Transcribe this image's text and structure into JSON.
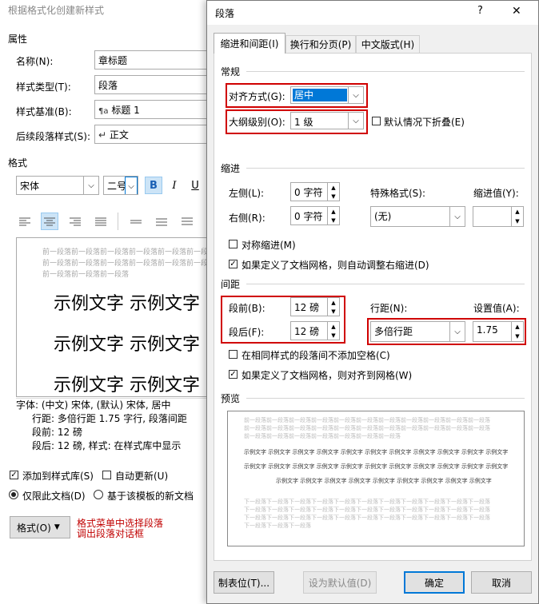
{
  "back_dialog": {
    "title": "根据格式化创建新样式",
    "properties_header": "属性",
    "name_label": "名称(N):",
    "name_value": "章标题",
    "style_type_label": "样式类型(T):",
    "style_type_value": "段落",
    "style_base_label": "样式基准(B):",
    "style_base_value": "标题 1",
    "style_base_icon": "¶a",
    "next_style_label": "后续段落样式(S):",
    "next_style_value": "正文",
    "next_style_icon": "↵",
    "format_header": "格式",
    "font_value": "宋体",
    "size_value": "二号",
    "bold": "B",
    "italic": "I",
    "underline": "U",
    "preview_prev_line1": "前一段落前一段落前一段落前一段落前一段落前一段落",
    "preview_prev_line2": "前一段落前一段落前一段落前一段落前一段落前一段落",
    "preview_prev_line3": "前一段落前一段落前一段落",
    "sample_text": "示例文字  示例文字",
    "desc_line1": "字体: (中文) 宋体, (默认) 宋体, 居中",
    "desc_line2": "行距: 多倍行距 1.75 字行, 段落间距",
    "desc_line3": "段前: 12 磅",
    "desc_line4": "段后: 12 磅, 样式: 在样式库中显示",
    "add_to_gallery": "添加到样式库(S)",
    "auto_update": "自动更新(U)",
    "only_this_doc": "仅限此文档(D)",
    "new_docs_template": "基于该模板的新文档",
    "format_button": "格式(O)",
    "annotation_line1": "格式菜单中选择段落",
    "annotation_line2": "调出段落对话框"
  },
  "dialog": {
    "title": "段落",
    "help": "?",
    "close": "✕",
    "tabs": [
      "缩进和间距(I)",
      "换行和分页(P)",
      "中文版式(H)"
    ],
    "general_header": "常规",
    "alignment_label": "对齐方式(G):",
    "alignment_value": "居中",
    "outline_label": "大纲级别(O):",
    "outline_value": "1 级",
    "collapse_default": "默认情况下折叠(E)",
    "indent_header": "缩进",
    "left_label": "左侧(L):",
    "left_value": "0 字符",
    "right_label": "右侧(R):",
    "right_value": "0 字符",
    "special_label": "特殊格式(S):",
    "special_value": "(无)",
    "indent_by_label": "缩进值(Y):",
    "indent_by_value": "",
    "mirror_indent": "对称缩进(M)",
    "auto_adjust_right": "如果定义了文档网格，则自动调整右缩进(D)",
    "spacing_header": "间距",
    "before_label": "段前(B):",
    "before_value": "12 磅",
    "after_label": "段后(F):",
    "after_value": "12 磅",
    "line_spacing_label": "行距(N):",
    "line_spacing_value": "多倍行距",
    "at_label": "设置值(A):",
    "at_value": "1.75",
    "no_space_same_style": "在相同样式的段落间不添加空格(C)",
    "snap_to_grid": "如果定义了文档网格，则对齐到网格(W)",
    "preview_header": "预览",
    "preview_prev": [
      "前一段落前一段落前一段落前一段落前一段落前一段落前一段落前一段落前一段落前一段落前一段落",
      "前一段落前一段落前一段落前一段落前一段落前一段落前一段落前一段落前一段落前一段落前一段落",
      "前一段落前一段落前一段落前一段落前一段落前一段落前一段落"
    ],
    "preview_sample": [
      "示例文字 示例文字 示例文字 示例文字 示例文字 示例文字 示例文字 示例文字 示例文字 示例文字 示例文字",
      "示例文字 示例文字 示例文字 示例文字 示例文字 示例文字 示例文字 示例文字 示例文字 示例文字 示例文字",
      "示例文字 示例文字 示例文字 示例文字 示例文字 示例文字 示例文字 示例文字 示例文字"
    ],
    "preview_next": [
      "下一段落下一段落下一段落下一段落下一段落下一段落下一段落下一段落下一段落下一段落下一段落",
      "下一段落下一段落下一段落下一段落下一段落下一段落下一段落下一段落下一段落下一段落下一段落",
      "下一段落下一段落下一段落下一段落下一段落下一段落下一段落下一段落下一段落下一段落下一段落",
      "下一段落下一段落下一段落"
    ],
    "tabs_button": "制表位(T)...",
    "set_default_button": "设为默认值(D)",
    "ok_button": "确定",
    "cancel_button": "取消"
  },
  "colors": {
    "highlight": "#d00000",
    "selection": "#0078d7",
    "annotation": "#c00000"
  }
}
